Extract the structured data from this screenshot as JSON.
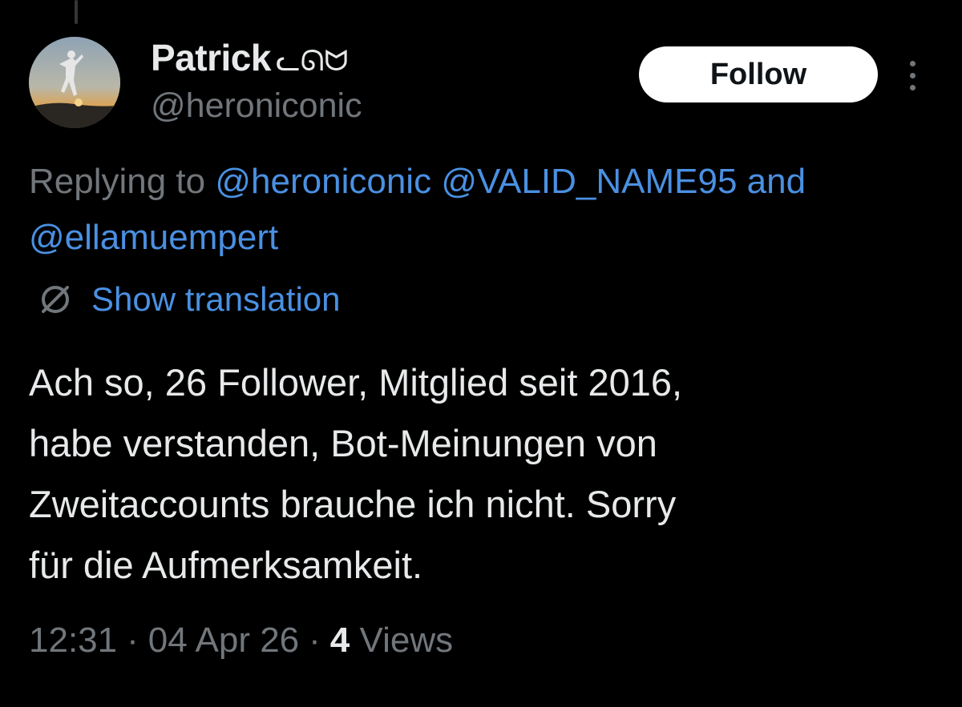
{
  "author": {
    "display_name": "Patrick",
    "name_emoji": "ᓚᘏᗢ",
    "handle": "@heroniconic"
  },
  "actions": {
    "follow_label": "Follow",
    "more_icon": "more-vertical-icon"
  },
  "reply": {
    "prefix": "Replying to",
    "mentions": [
      "@heroniconic",
      "@VALID_NAME95"
    ],
    "conjunction": "and",
    "last_mention": "@ellamuempert"
  },
  "translation": {
    "icon": "globe-icon",
    "label": "Show translation"
  },
  "tweet": {
    "text": "Ach so, 26 Follower, Mitglied seit 2016,\nhabe verstanden, Bot-Meinungen von\nZweitaccounts brauche ich nicht. Sorry\nfür die Aufmerksamkeit."
  },
  "meta": {
    "time": "12:31",
    "date": "04 Apr 26",
    "separator": "·",
    "views_count": "4",
    "views_label": "Views"
  },
  "colors": {
    "background": "#000000",
    "text_primary": "#e7e9ea",
    "text_secondary": "#71767b",
    "link": "#4a90e2",
    "button_bg": "#ffffff"
  }
}
